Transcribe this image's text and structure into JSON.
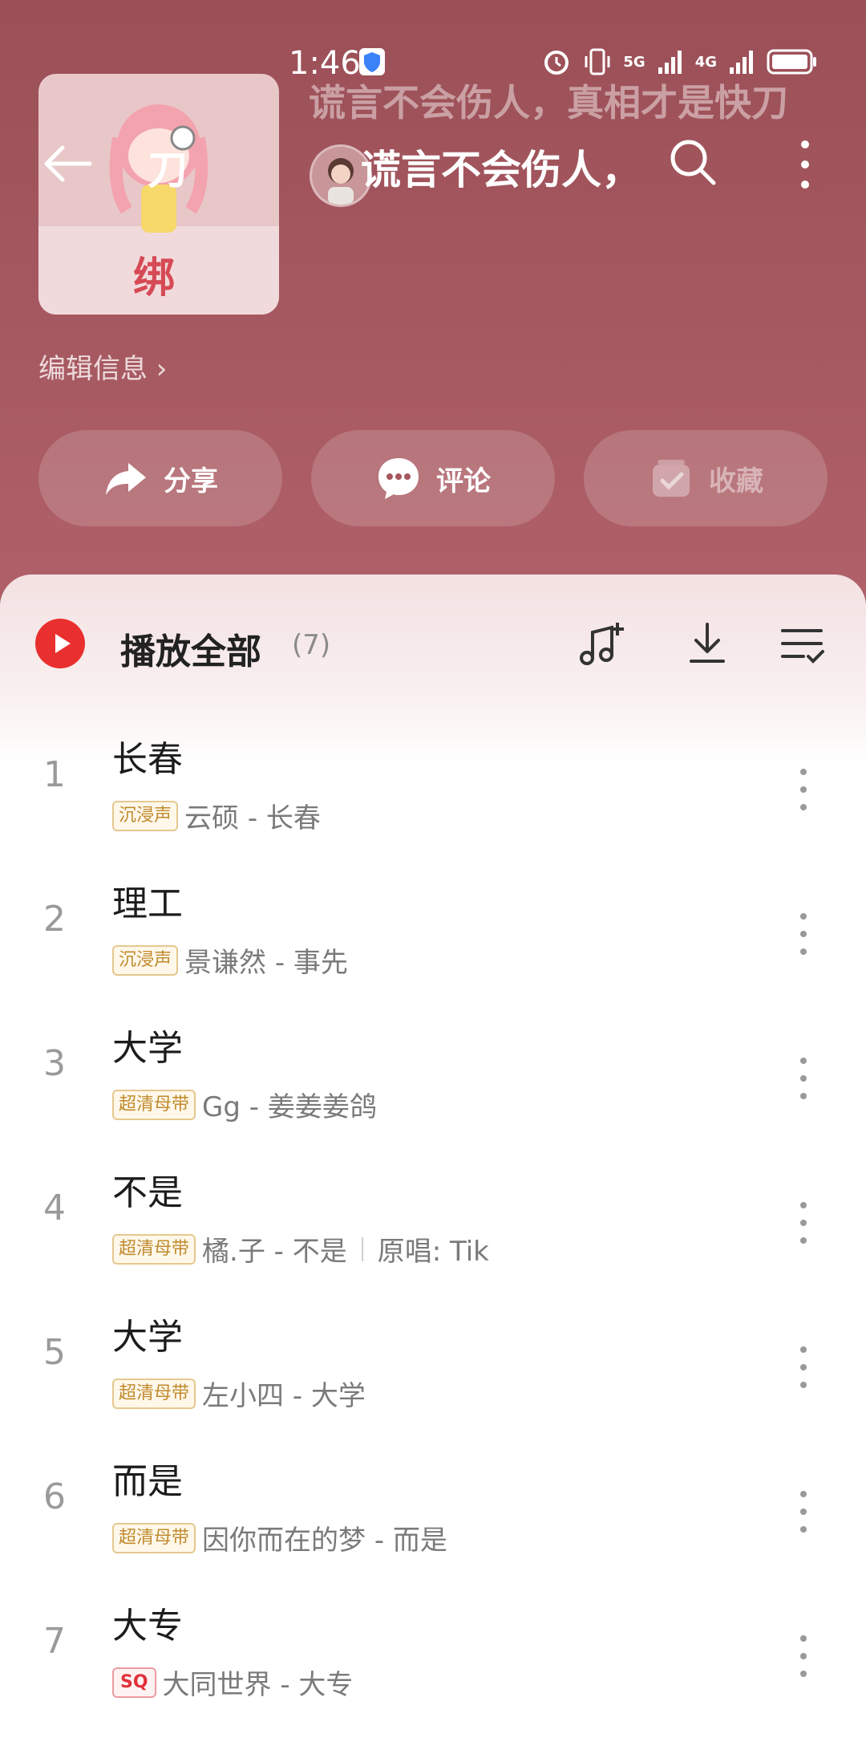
{
  "status_bar": {
    "time": "1:46",
    "sig_5g": "5G",
    "sig_4g": "4G"
  },
  "header": {
    "back_title": "刀",
    "bg_title": "谎言不会伤人，真相才是快刀",
    "title": "谎言不会伤人，",
    "cover_text": "绑",
    "edit_info": "编辑信息 ›"
  },
  "actions": {
    "share": "分享",
    "comment": "评论",
    "favorite": "收藏"
  },
  "playlist": {
    "play_all": "播放全部",
    "count": "(7)",
    "songs": [
      {
        "index": "1",
        "title": "长春",
        "badge": "沉浸声",
        "badge_type": "gold",
        "artist_song": "云硕 - 长春",
        "extra": ""
      },
      {
        "index": "2",
        "title": "理工",
        "badge": "沉浸声",
        "badge_type": "gold",
        "artist_song": "景谦然 - 事先",
        "extra": ""
      },
      {
        "index": "3",
        "title": "大学",
        "badge": "超清母带",
        "badge_type": "gold",
        "artist_song": "Gg - 姜姜姜鸽",
        "extra": ""
      },
      {
        "index": "4",
        "title": "不是",
        "badge": "超清母带",
        "badge_type": "gold",
        "artist_song": "橘.子 - 不是",
        "extra": "原唱: Tik"
      },
      {
        "index": "5",
        "title": "大学",
        "badge": "超清母带",
        "badge_type": "gold",
        "artist_song": "左小四 - 大学",
        "extra": ""
      },
      {
        "index": "6",
        "title": "而是",
        "badge": "超清母带",
        "badge_type": "gold",
        "artist_song": "因你而在的梦 - 而是",
        "extra": ""
      },
      {
        "index": "7",
        "title": "大专",
        "badge": "SQ",
        "badge_type": "sq",
        "artist_song": "大同世界 - 大专",
        "extra": ""
      }
    ]
  },
  "colors": {
    "header_bg": "#a6565e",
    "play_red": "#ea2f2f",
    "badge_gold": "#c08a2d",
    "badge_sq": "#e0323c"
  }
}
